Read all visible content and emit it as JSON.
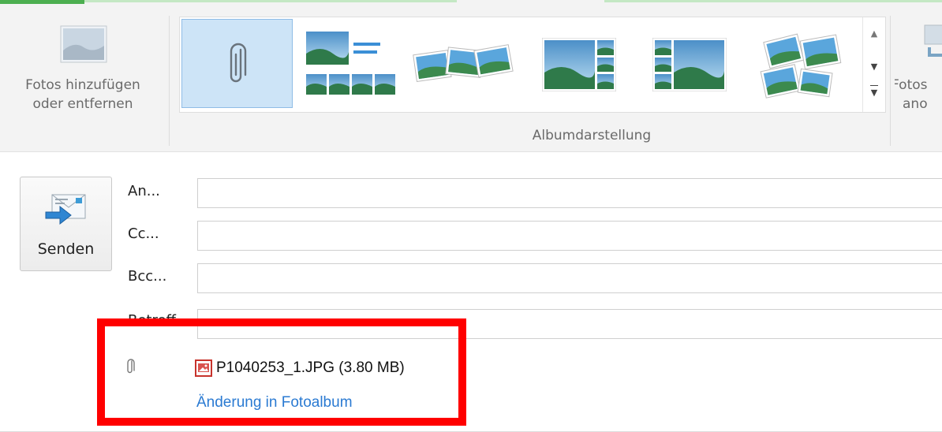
{
  "ribbon": {
    "add_remove_photos": {
      "line1": "Fotos hinzufügen",
      "line2": "oder entfernen",
      "icon": "landscape-photo-icon"
    },
    "gallery": {
      "group_label": "Albumdarstellung",
      "items": [
        {
          "name": "attachment-layout",
          "icon": "paperclip-icon",
          "selected": true
        },
        {
          "name": "single-photo-grid-layout",
          "icon": "photo-grid-icon",
          "selected": false
        },
        {
          "name": "photo-strip-layout",
          "icon": "photo-strip-icon",
          "selected": false
        },
        {
          "name": "large-with-thumbs-right-layout",
          "icon": "photo-thumbs-right-icon",
          "selected": false
        },
        {
          "name": "large-with-thumbs-left-layout",
          "icon": "photo-thumbs-left-icon",
          "selected": false
        },
        {
          "name": "collage-layout",
          "icon": "photo-collage-icon",
          "selected": false
        }
      ]
    },
    "rotate_photos": {
      "line1": "Fotos",
      "line2": "ano"
    },
    "colors": {
      "tab_accent": "#4caf50",
      "selected_fill": "#cde4f7",
      "selected_border": "#8fbce6"
    }
  },
  "compose": {
    "send_label": "Senden",
    "fields": [
      {
        "label": "An...",
        "value": ""
      },
      {
        "label": "Cc...",
        "value": ""
      },
      {
        "label": "Bcc...",
        "value": ""
      },
      {
        "label": "Betreff",
        "value": ""
      }
    ],
    "attachment": {
      "file": "P1040253_1.JPG (3.80 MB)",
      "link": "Änderung in Fotoalbum"
    },
    "colors": {
      "link": "#2a7ad2",
      "highlight_box": "#ff0000"
    }
  }
}
